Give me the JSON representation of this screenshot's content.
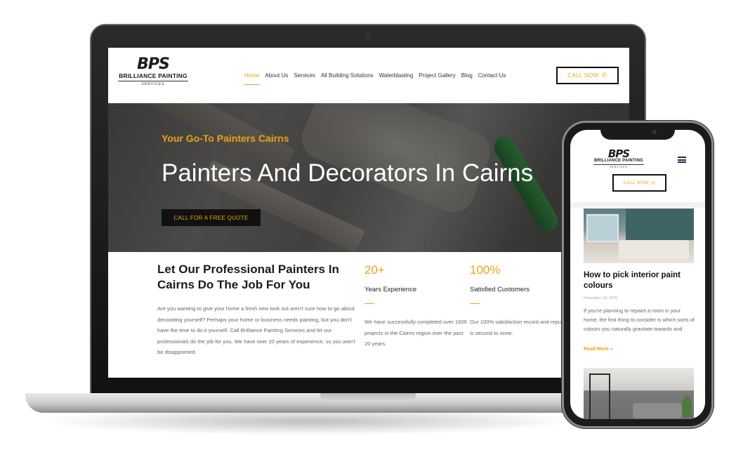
{
  "brand": {
    "logo_mark": "BPS",
    "logo_name": "BRILLIANCE PAINTING",
    "logo_sub": "SERVICES"
  },
  "nav": {
    "items": [
      "Home",
      "About Us",
      "Services",
      "All Building Solutions",
      "Waterblasting",
      "Project Gallery",
      "Blog",
      "Contact Us"
    ],
    "active": "Home",
    "call_label": "CALL NOW",
    "call_icon": "phone-icon"
  },
  "hero": {
    "tagline": "Your Go-To Painters Cairns",
    "title": "Painters And Decorators In Cairns",
    "button_label": "CALL FOR A FREE QUOTE"
  },
  "intro": {
    "heading": "Let Our Professional Painters In Cairns Do The Job For You",
    "text": "Are you wanting to give your home a fresh new look out aren't sure how to go about decorating yourself? Perhaps your home or business needs painting, but you don't have the time to do it yourself. Call Brilliance Painting Services and let our professionals do the job for you. We have over 20 years of experience, so you won't be disappointed."
  },
  "stats": [
    {
      "number": "20+",
      "label": "Years Experience",
      "text": "We have successfully completed over 1600 projects in the Cairns region over the past 20 years."
    },
    {
      "number": "100%",
      "label": "Satisfied Customers",
      "text": "Our 100% satisfaction record and reputation is second to none."
    }
  ],
  "mobile": {
    "call_label": "CALL NOW",
    "post": {
      "title": "How to pick interior paint colours",
      "date": "November 18, 2020",
      "excerpt": "If you're planning to repaint a room in your home, the first thing to consider is which sorts of colours you naturally gravitate towards and",
      "read_more": "Read More »"
    }
  },
  "colors": {
    "accent": "#e8a317",
    "dark": "#111111",
    "text": "#666666"
  }
}
